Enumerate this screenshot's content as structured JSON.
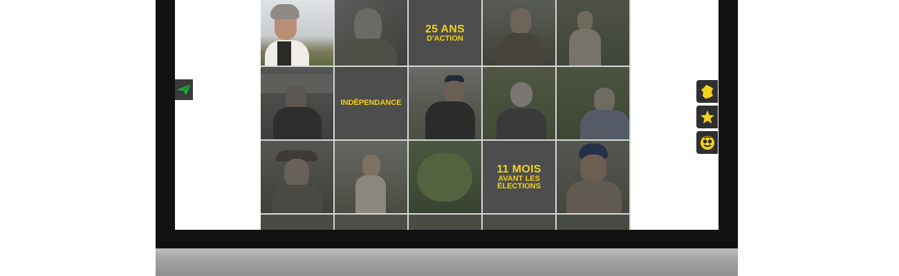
{
  "tiles": {
    "action": {
      "big": "25 ANS",
      "small": "D'ACTION"
    },
    "independance": {
      "label": "INDÉPENDANCE"
    },
    "mois": {
      "big": "11 MOIS",
      "small1": "AVANT LES",
      "small2": "ÉLECTIONS"
    }
  },
  "icons": {
    "send": "paper-plane-icon",
    "france": "france-map-icon",
    "star": "star-icon",
    "mascot": "face-icon"
  },
  "colors": {
    "accent": "#f2d21b",
    "send_icon": "#1fa83a",
    "tile_bg": "#4d4d4d",
    "bezel": "#111111"
  }
}
